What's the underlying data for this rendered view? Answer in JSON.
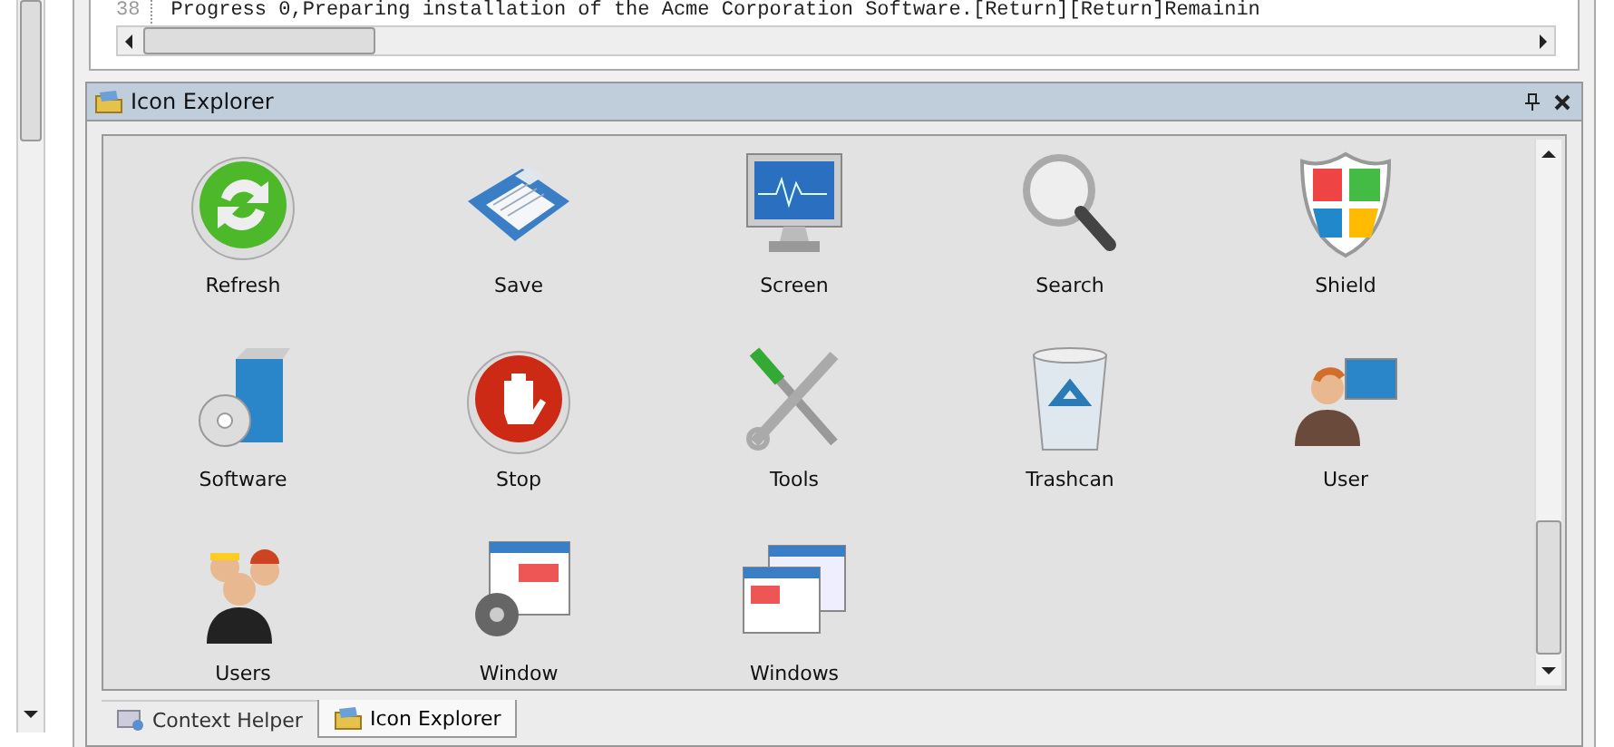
{
  "editor": {
    "line_number": "38",
    "code": "Progress 0,Preparing installation of the Acme Corporation Software.[Return][Return]Remainin"
  },
  "panel": {
    "title": "Icon Explorer"
  },
  "icons": [
    {
      "label": "Refresh",
      "kind": "refresh"
    },
    {
      "label": "Save",
      "kind": "save"
    },
    {
      "label": "Screen",
      "kind": "screen"
    },
    {
      "label": "Search",
      "kind": "search"
    },
    {
      "label": "Shield",
      "kind": "shield"
    },
    {
      "label": "Software",
      "kind": "software"
    },
    {
      "label": "Stop",
      "kind": "stop"
    },
    {
      "label": "Tools",
      "kind": "tools"
    },
    {
      "label": "Trashcan",
      "kind": "trashcan"
    },
    {
      "label": "User",
      "kind": "user"
    },
    {
      "label": "Users",
      "kind": "users"
    },
    {
      "label": "Window",
      "kind": "window"
    },
    {
      "label": "Windows",
      "kind": "windows"
    }
  ],
  "tabs": [
    {
      "label": "Context Helper",
      "kind": "helper",
      "selected": false
    },
    {
      "label": "Icon Explorer",
      "kind": "explorer",
      "selected": true
    }
  ]
}
